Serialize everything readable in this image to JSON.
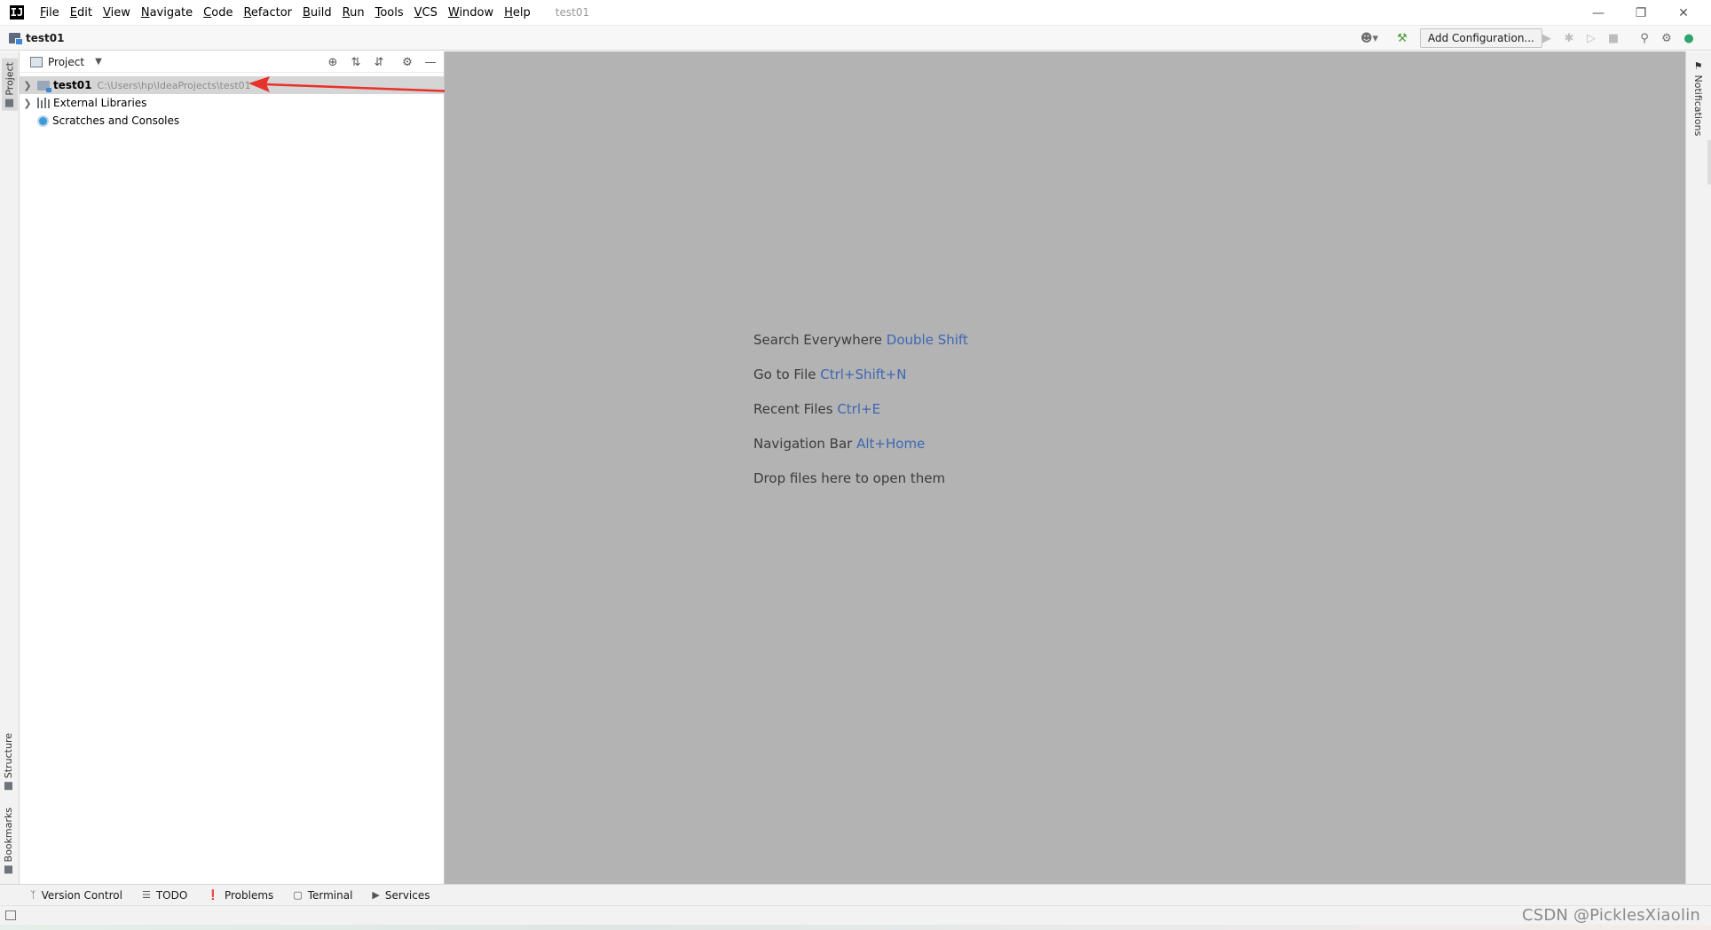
{
  "window": {
    "title": "test01",
    "menu": [
      {
        "label": "File",
        "mnemonic": "F",
        "rest": "ile"
      },
      {
        "label": "Edit",
        "mnemonic": "E",
        "rest": "dit"
      },
      {
        "label": "View",
        "mnemonic": "V",
        "rest": "iew"
      },
      {
        "label": "Navigate",
        "mnemonic": "N",
        "rest": "avigate"
      },
      {
        "label": "Code",
        "mnemonic": "C",
        "rest": "ode"
      },
      {
        "label": "Refactor",
        "mnemonic": "R",
        "rest": "efactor"
      },
      {
        "label": "Build",
        "mnemonic": "B",
        "rest": "uild"
      },
      {
        "label": "Run",
        "mnemonic": "R",
        "rest": "un"
      },
      {
        "label": "Tools",
        "mnemonic": "T",
        "rest": "ools"
      },
      {
        "label": "VCS",
        "mnemonic": "V",
        "rest": "CS"
      },
      {
        "label": "Window",
        "mnemonic": "W",
        "rest": "indow"
      },
      {
        "label": "Help",
        "mnemonic": "H",
        "rest": "elp"
      }
    ]
  },
  "navbar": {
    "breadcrumb": "test01",
    "add_configuration": "Add Configuration..."
  },
  "left_stripe": {
    "project_tab": "Project",
    "structure_tab": "Structure",
    "bookmarks_tab": "Bookmarks"
  },
  "project_panel": {
    "title": "Project",
    "tree": [
      {
        "label": "test01",
        "path": "C:\\Users\\hp\\IdeaProjects\\test01",
        "expandable": true,
        "selected": true
      },
      {
        "label": "External Libraries",
        "path": "",
        "expandable": true,
        "selected": false
      },
      {
        "label": "Scratches and Consoles",
        "path": "",
        "expandable": false,
        "selected": false
      }
    ]
  },
  "editor": {
    "hints": [
      {
        "text": "Search Everywhere",
        "shortcut": "Double Shift"
      },
      {
        "text": "Go to File",
        "shortcut": "Ctrl+Shift+N"
      },
      {
        "text": "Recent Files",
        "shortcut": "Ctrl+E"
      },
      {
        "text": "Navigation Bar",
        "shortcut": "Alt+Home"
      },
      {
        "text": "Drop files here to open them",
        "shortcut": ""
      }
    ]
  },
  "right_stripe": {
    "notifications_tab": "Notifications"
  },
  "bottom_tools": {
    "version_control": "Version Control",
    "todo": "TODO",
    "problems": "Problems",
    "terminal": "Terminal",
    "services": "Services"
  },
  "watermark": "CSDN @PicklesXiaolin",
  "colors": {
    "editor_background": "#b3b3b3",
    "shortcut_text": "#3d67b4",
    "annotation_arrow": "#e8312a",
    "selected_row": "#d5d5d5"
  }
}
